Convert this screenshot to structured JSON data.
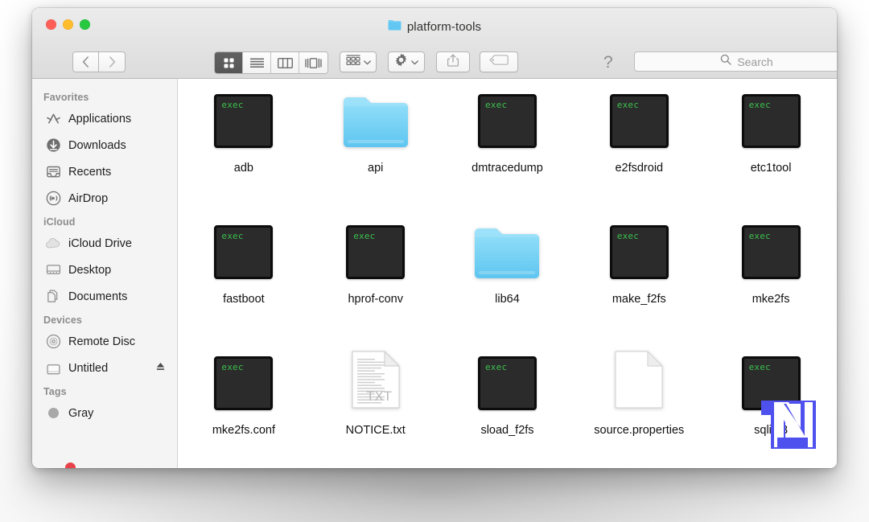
{
  "window": {
    "title": "platform-tools",
    "title_icon": "folder-icon",
    "traffic_lights": [
      {
        "name": "close",
        "color": "#ff5f57"
      },
      {
        "name": "minimize",
        "color": "#ffbd2e"
      },
      {
        "name": "zoom",
        "color": "#28c840"
      }
    ]
  },
  "toolbar": {
    "back_icon": "chevron-left-icon",
    "forward_icon": "chevron-right-icon",
    "view_modes": [
      {
        "name": "icon-view",
        "icon": "grid-icon",
        "active": true
      },
      {
        "name": "list-view",
        "icon": "list-icon",
        "active": false
      },
      {
        "name": "column-view",
        "icon": "columns-icon",
        "active": false
      },
      {
        "name": "gallery-view",
        "icon": "gallery-icon",
        "active": false
      }
    ],
    "arrange_icon": "arrange-grid-icon",
    "action_icon": "gear-icon",
    "share_icon": "share-icon",
    "tag_icon": "tag-icon",
    "help_icon": "question-mark-icon",
    "dropdown_icon": "chevron-down-icon"
  },
  "search": {
    "icon": "search-icon",
    "placeholder": "Search",
    "value": ""
  },
  "sidebar": {
    "groups": [
      {
        "label": "Favorites",
        "items": [
          {
            "label": "Applications",
            "icon": "applications-icon"
          },
          {
            "label": "Downloads",
            "icon": "downloads-icon"
          },
          {
            "label": "Recents",
            "icon": "recents-icon"
          },
          {
            "label": "AirDrop",
            "icon": "airdrop-icon"
          }
        ]
      },
      {
        "label": "iCloud",
        "items": [
          {
            "label": "iCloud Drive",
            "icon": "cloud-icon"
          },
          {
            "label": "Desktop",
            "icon": "desktop-icon"
          },
          {
            "label": "Documents",
            "icon": "documents-icon"
          }
        ]
      },
      {
        "label": "Devices",
        "items": [
          {
            "label": "Remote Disc",
            "icon": "disc-icon"
          },
          {
            "label": "Untitled",
            "icon": "drive-icon",
            "eject": "eject-icon"
          }
        ]
      },
      {
        "label": "Tags",
        "items": [
          {
            "label": "Gray",
            "icon": "tag-dot-icon",
            "color": "#a8a8a8"
          }
        ]
      }
    ]
  },
  "files": [
    {
      "name": "adb",
      "type": "exec",
      "badge": "exec"
    },
    {
      "name": "api",
      "type": "folder"
    },
    {
      "name": "dmtracedump",
      "type": "exec",
      "badge": "exec"
    },
    {
      "name": "e2fsdroid",
      "type": "exec",
      "badge": "exec"
    },
    {
      "name": "etc1tool",
      "type": "exec",
      "badge": "exec"
    },
    {
      "name": "fastboot",
      "type": "exec",
      "badge": "exec"
    },
    {
      "name": "hprof-conv",
      "type": "exec",
      "badge": "exec"
    },
    {
      "name": "lib64",
      "type": "folder"
    },
    {
      "name": "make_f2fs",
      "type": "exec",
      "badge": "exec"
    },
    {
      "name": "mke2fs",
      "type": "exec",
      "badge": "exec"
    },
    {
      "name": "mke2fs.conf",
      "type": "exec",
      "badge": "exec"
    },
    {
      "name": "NOTICE.txt",
      "type": "text-document",
      "badge": "TXT"
    },
    {
      "name": "sload_f2fs",
      "type": "exec",
      "badge": "exec"
    },
    {
      "name": "source.properties",
      "type": "blank-document"
    },
    {
      "name": "sqlite3",
      "type": "exec",
      "badge": "exec"
    }
  ],
  "watermark": {
    "name": "nt-logo",
    "color": "#4e51ee"
  },
  "colors": {
    "exec_badge_text": "#3cbf4e",
    "exec_background": "#2b2b2b",
    "folder_blue": "#6fcef5",
    "sidebar_background": "#f4f4f4",
    "titlebar_background": "#e6e6e6"
  }
}
